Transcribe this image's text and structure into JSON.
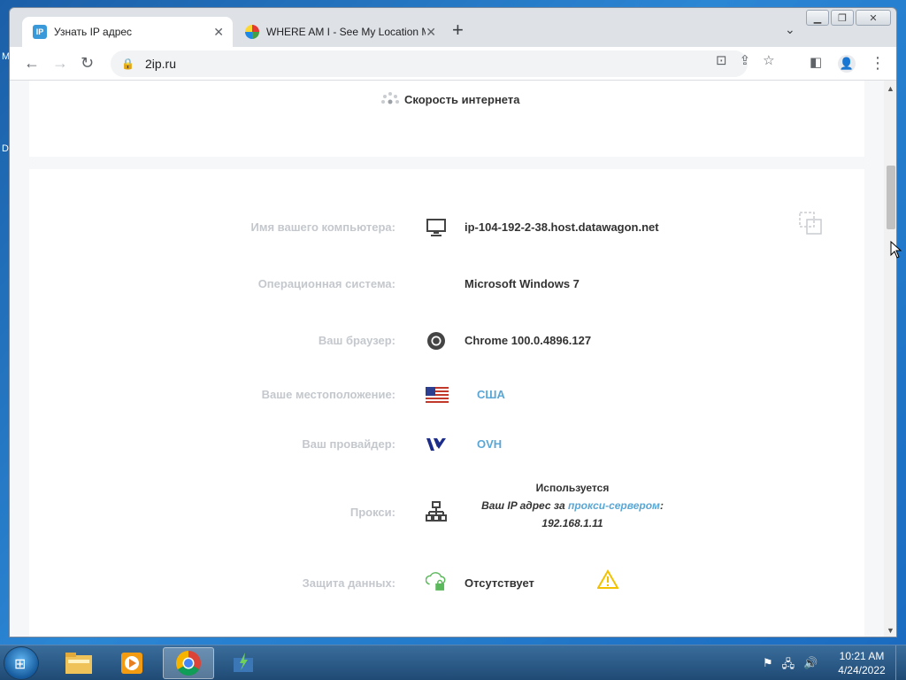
{
  "desktop": {
    "edge_top": "M",
    "edge_mid": "D"
  },
  "browser": {
    "tabs": [
      {
        "label": "Узнать IP адрес",
        "favicon": "IP",
        "active": true
      },
      {
        "label": "WHERE AM I - See My Location M",
        "favicon": "",
        "active": false
      }
    ],
    "new_tab": "+",
    "address": "2ip.ru",
    "window_buttons": {
      "minimize": "▁",
      "maximize": "❐",
      "close": "✕"
    }
  },
  "page": {
    "speed_label": "Скорость интернета",
    "rows": {
      "computer": {
        "key": "Имя вашего компьютера:",
        "value": "ip-104-192-2-38.host.datawagon.net"
      },
      "os": {
        "key": "Операционная система:",
        "value": "Microsoft Windows 7"
      },
      "browser": {
        "key": "Ваш браузер:",
        "value": "Chrome 100.0.4896.127"
      },
      "location": {
        "key": "Ваше местоположение:",
        "value": "США"
      },
      "provider": {
        "key": "Ваш провайдер:",
        "value": "OVH"
      },
      "proxy": {
        "key": "Прокси:",
        "status": "Используется",
        "line_prefix": "Ваш IP адрес за ",
        "line_link": "прокси-сервером",
        "line_suffix": ":",
        "proxy_ip": "192.168.1.11"
      },
      "protection": {
        "key": "Защита данных:",
        "value": "Отсутствует"
      }
    }
  },
  "taskbar": {
    "time": "10:21 AM",
    "date": "4/24/2022"
  },
  "colors": {
    "link": "#5aa7d6",
    "warning": "#f2c200",
    "lock_green": "#5cb85c"
  }
}
